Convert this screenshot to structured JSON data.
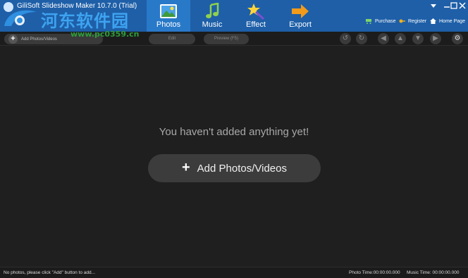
{
  "window": {
    "title": "GiliSoft Slideshow Maker 10.7.0 (Trial)"
  },
  "watermark": {
    "text": "河东软件园",
    "url": "www.pc0359.cn"
  },
  "main_tabs": [
    {
      "label": "Photos",
      "icon": "photo-icon",
      "active": true
    },
    {
      "label": "Music",
      "icon": "music-note-icon",
      "active": false
    },
    {
      "label": "Effect",
      "icon": "magic-wand-icon",
      "active": false
    },
    {
      "label": "Export",
      "icon": "arrow-right-icon",
      "active": false
    }
  ],
  "header_links": {
    "purchase": "Purchase",
    "register": "Register",
    "home": "Home Page"
  },
  "toolbar": {
    "add_label": "Add Photos/Videos",
    "edit_label": "Edit",
    "preview_label": "Preview (F5)"
  },
  "main": {
    "empty_message": "You haven't added anything yet!",
    "add_button_label": "Add Photos/Videos"
  },
  "status": {
    "message": "No photos, please click \"Add\" button to add...",
    "photo_time_label": "Photo Time:",
    "photo_time": "00:00:00.000",
    "music_time_label": "Music Time:",
    "music_time": "00:00:00.000"
  },
  "colors": {
    "titlebar": "#1e5fa8",
    "active_tab": "#2979c9",
    "background": "#1f1f1f"
  }
}
